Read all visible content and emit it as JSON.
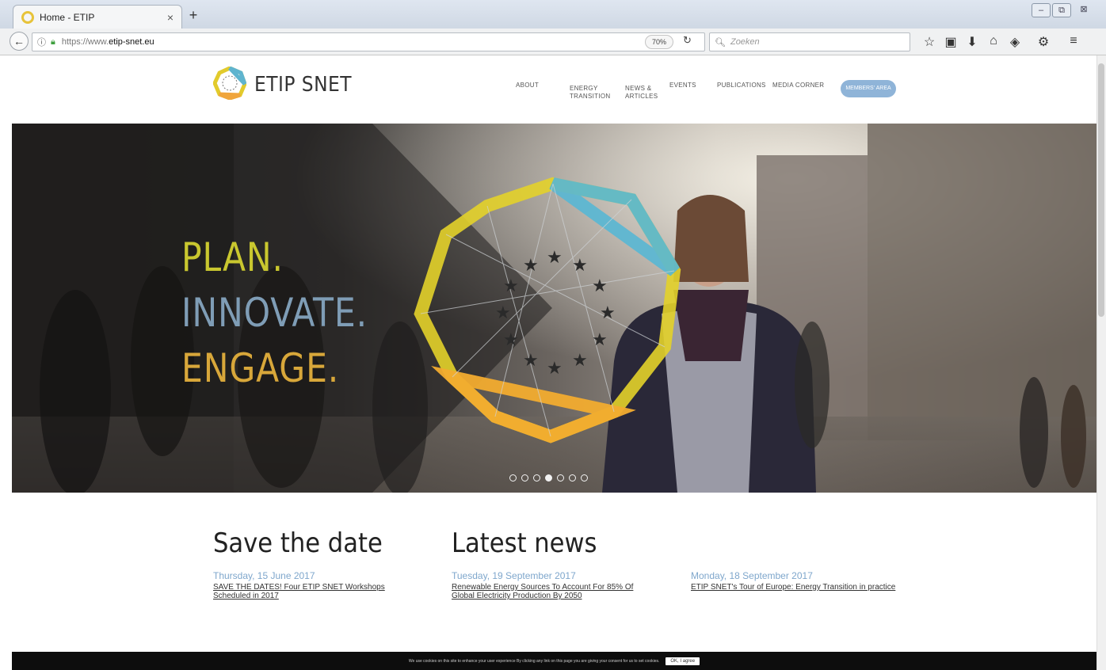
{
  "browser": {
    "tab_title": "Home - ETIP",
    "tab_close": "×",
    "new_tab": "+",
    "url_prefix": "https://www.",
    "url_domain": "etip-snet.eu",
    "zoom": "70%",
    "search_placeholder": "Zoeken",
    "window_minimize": "–",
    "window_restore": "⧉",
    "window_close": "⊠"
  },
  "site": {
    "logo_text": "ETIP SNET",
    "nav": [
      {
        "label": "ABOUT"
      },
      {
        "label": "ENERGY\nTRANSITION"
      },
      {
        "label": "NEWS &\nARTICLES"
      },
      {
        "label": "EVENTS"
      },
      {
        "label": "PUBLICATIONS"
      },
      {
        "label": "MEDIA CORNER"
      }
    ],
    "member_button": "MEMBERS' AREA"
  },
  "hero": {
    "line1": "PLAN.",
    "line2": "INNOVATE.",
    "line3": "ENGAGE.",
    "colors": {
      "line1": "#c9c72f",
      "line2": "#7f9db6",
      "line3": "#d8a73a"
    },
    "slide_count": 7,
    "active_slide": 3
  },
  "save_the_date": {
    "title": "Save the date",
    "items": [
      {
        "date": "Thursday, 15 June 2017",
        "text": "SAVE THE DATES! Four ETIP SNET Workshops Scheduled in 2017"
      }
    ]
  },
  "latest_news": {
    "title": "Latest news",
    "items": [
      {
        "date": "Tuesday, 19 September 2017",
        "text": "Renewable Energy Sources To Account For 85% Of Global Electricity Production By 2050"
      },
      {
        "date": "Monday, 18 September 2017",
        "text": "ETIP SNET's Tour of Europe: Energy Transition in practice"
      }
    ]
  },
  "cookie": {
    "text": "We use cookies on this site to enhance your user experience By clicking any link on this page you are giving your consent for us to set cookies.",
    "button": "OK, I agree"
  }
}
